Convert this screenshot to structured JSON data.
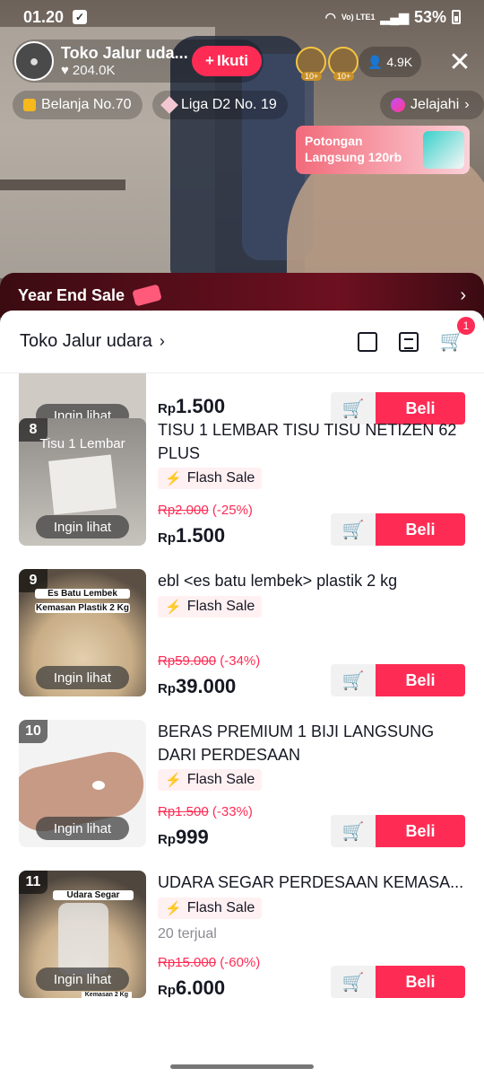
{
  "status_bar": {
    "time": "01.20",
    "network": "Vo) LTE1",
    "battery": "53%"
  },
  "live": {
    "host_name": "Toko Jalur uda...",
    "likes": "204.0K",
    "follow_label": "Ikuti",
    "viewer_badges": [
      "10+",
      "10+"
    ],
    "viewer_count": "4.9K",
    "tags": [
      "Belanja No.70",
      "Liga D2 No. 19",
      "Jelajahi"
    ],
    "promo": "Potongan Langsung 120rb",
    "banner": "Year End Sale"
  },
  "shop": {
    "title": "Toko Jalur udara",
    "cart_count": "1"
  },
  "products": [
    {
      "num": "",
      "name": "",
      "flash": "",
      "sold": "",
      "old_price": "",
      "discount": "",
      "currency": "Rp",
      "price": "1.500",
      "want": "Ingin lihat",
      "buy": "Beli"
    },
    {
      "num": "8",
      "thumb_caption": "Tisu 1 Lembar",
      "name": "TISU 1 LEMBAR TISU TISU NETIZEN 62 PLUS",
      "flash": "Flash Sale",
      "old_price": "Rp2.000",
      "discount": "(-25%)",
      "currency": "Rp",
      "price": "1.500",
      "want": "Ingin lihat",
      "buy": "Beli"
    },
    {
      "num": "9",
      "thumb_caption": "Es Batu Lembek",
      "thumb_caption2": "Kemasan Plastik 2 Kg",
      "name": "ebl <es batu lembek>  plastik 2 kg",
      "flash": "Flash Sale",
      "old_price": "Rp59.000",
      "discount": "(-34%)",
      "currency": "Rp",
      "price": "39.000",
      "want": "Ingin lihat",
      "buy": "Beli"
    },
    {
      "num": "10",
      "name": "BERAS PREMIUM 1 BIJI LANGSUNG DARI PERDESAAN",
      "flash": "Flash Sale",
      "old_price": "Rp1.500",
      "discount": "(-33%)",
      "currency": "Rp",
      "price": "999",
      "want": "Ingin lihat",
      "buy": "Beli"
    },
    {
      "num": "11",
      "thumb_caption": "Udara Segar",
      "thumb_caption2": "Kemasan 2 Kg",
      "name": "UDARA SEGAR PERDESAAN KEMASA...",
      "flash": "Flash Sale",
      "sold": "20 terjual",
      "old_price": "Rp15.000",
      "discount": "(-60%)",
      "currency": "Rp",
      "price": "6.000",
      "want": "Ingin lihat",
      "buy": "Beli"
    }
  ]
}
